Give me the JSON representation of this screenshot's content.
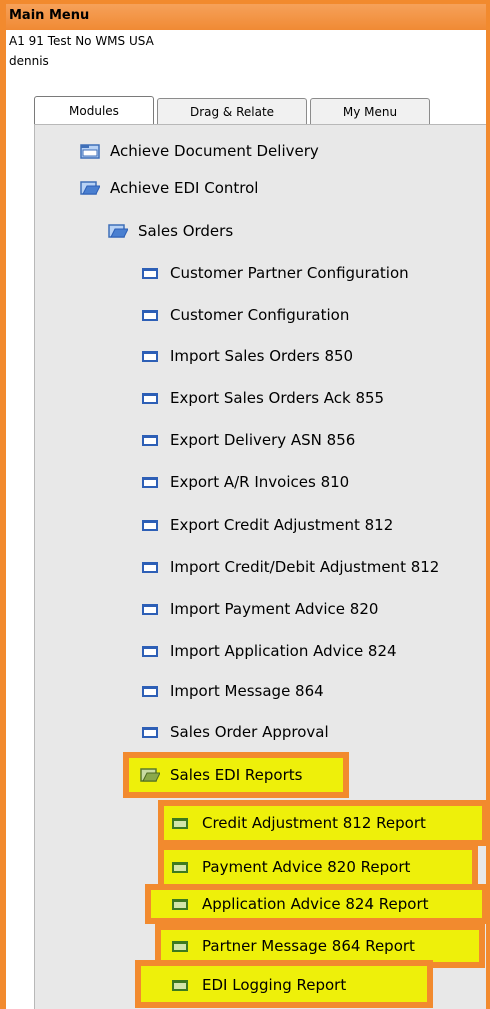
{
  "window": {
    "title": "Main Menu",
    "company": "A1 91 Test No WMS USA",
    "user": "dennis"
  },
  "tabs": [
    {
      "label": "Modules",
      "active": true
    },
    {
      "label": "Drag & Relate",
      "active": false
    },
    {
      "label": "My Menu",
      "active": false
    }
  ],
  "menu": {
    "doc_delivery": "Achieve Document Delivery",
    "edi_control": "Achieve EDI Control",
    "sales_orders": "Sales Orders",
    "items": [
      "Customer Partner Configuration",
      "Customer Configuration",
      "Import Sales Orders 850",
      "Export Sales Orders Ack 855",
      "Export Delivery ASN 856",
      "Export A/R Invoices 810",
      "Export Credit Adjustment 812",
      "Import Credit/Debit Adjustment 812",
      "Import Payment Advice 820",
      "Import Application Advice 824",
      "Import Message 864",
      "Sales Order Approval"
    ],
    "edi_reports": "Sales EDI Reports",
    "reports": [
      "Credit Adjustment 812 Report",
      "Payment Advice 820 Report",
      "Application Advice 824 Report",
      "Partner Message 864 Report",
      "EDI Logging Report"
    ]
  },
  "colors": {
    "highlight_border": "#f28a2e",
    "highlight_fill": "#eef00a",
    "folder": "#4a7fd0",
    "report_icon": "#3e7a1e"
  }
}
